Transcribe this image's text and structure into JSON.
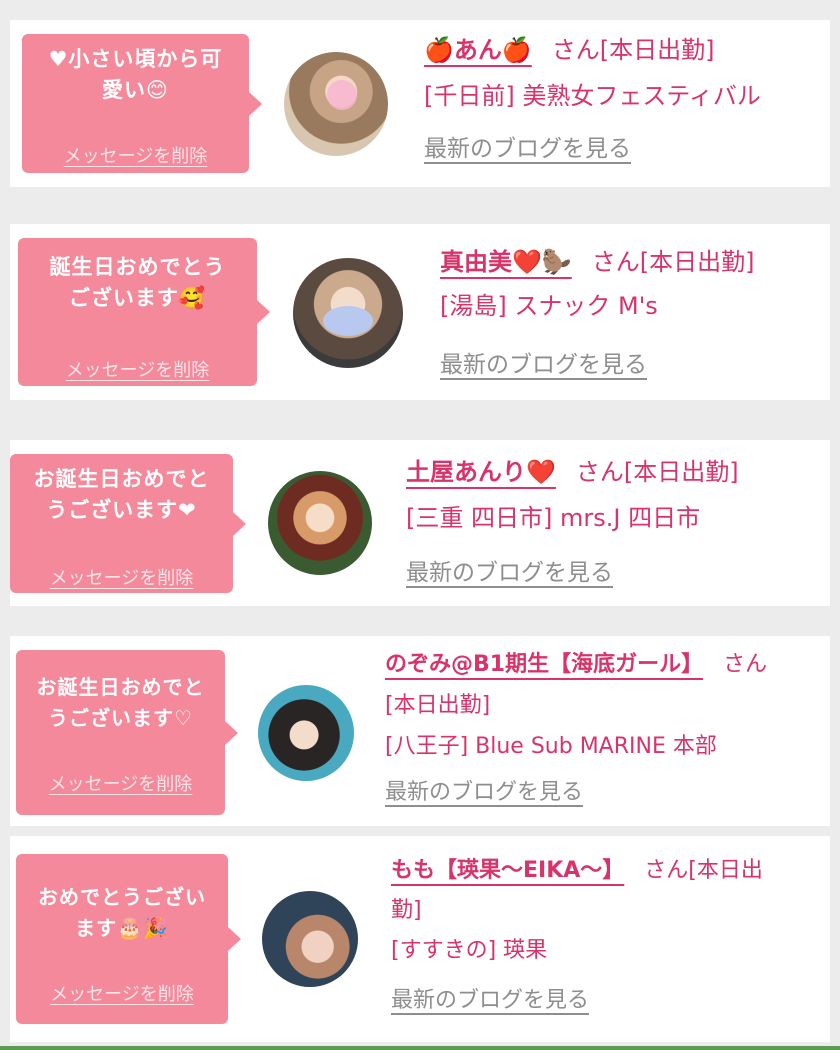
{
  "entries": [
    {
      "message_lines": [
        "♥小さい頃から可",
        "愛い😊"
      ],
      "delete_label": "メッセージを削除",
      "name": "🍎あん🍎",
      "suffix": "さん[本日出勤]",
      "shop": "[千日前] 美熟女フェスティバル",
      "blog_label": "最新のブログを見る"
    },
    {
      "message_lines": [
        "誕生日おめでとう",
        "ございます🥰"
      ],
      "delete_label": "メッセージを削除",
      "name": "真由美❤️🦫",
      "suffix": "さん[本日出勤]",
      "shop": "[湯島] スナック M's",
      "blog_label": "最新のブログを見る"
    },
    {
      "message_lines": [
        "お誕生日おめでと",
        "うございます❤"
      ],
      "delete_label": "メッセージを削除",
      "name": "土屋あんり❤️",
      "suffix": "さん[本日出勤]",
      "shop": "[三重 四日市] mrs.J 四日市",
      "blog_label": "最新のブログを見る"
    },
    {
      "message_lines": [
        "お誕生日おめでと",
        "うございます♡"
      ],
      "delete_label": "メッセージを削除",
      "name": "のぞみ@B1期生【海底ガール】",
      "suffix": "さん",
      "status": "[本日出勤]",
      "shop": "[八王子] Blue Sub MARINE 本部",
      "blog_label": "最新のブログを見る"
    },
    {
      "message_lines": [
        "おめでとうござい",
        "ます🎂🎉"
      ],
      "delete_label": "メッセージを削除",
      "name": "もも【瑛果〜EIKA〜】",
      "suffix": "さん[本日出",
      "status": "勤]",
      "shop": "[すすきの] 瑛果",
      "blog_label": "最新のブログを見る"
    }
  ],
  "colors": {
    "bubble": "#f4899b",
    "accent": "#d8346a",
    "link_gray": "#8e8e8e",
    "background": "#ececec"
  },
  "icons": [
    "face-photo-avatar"
  ]
}
